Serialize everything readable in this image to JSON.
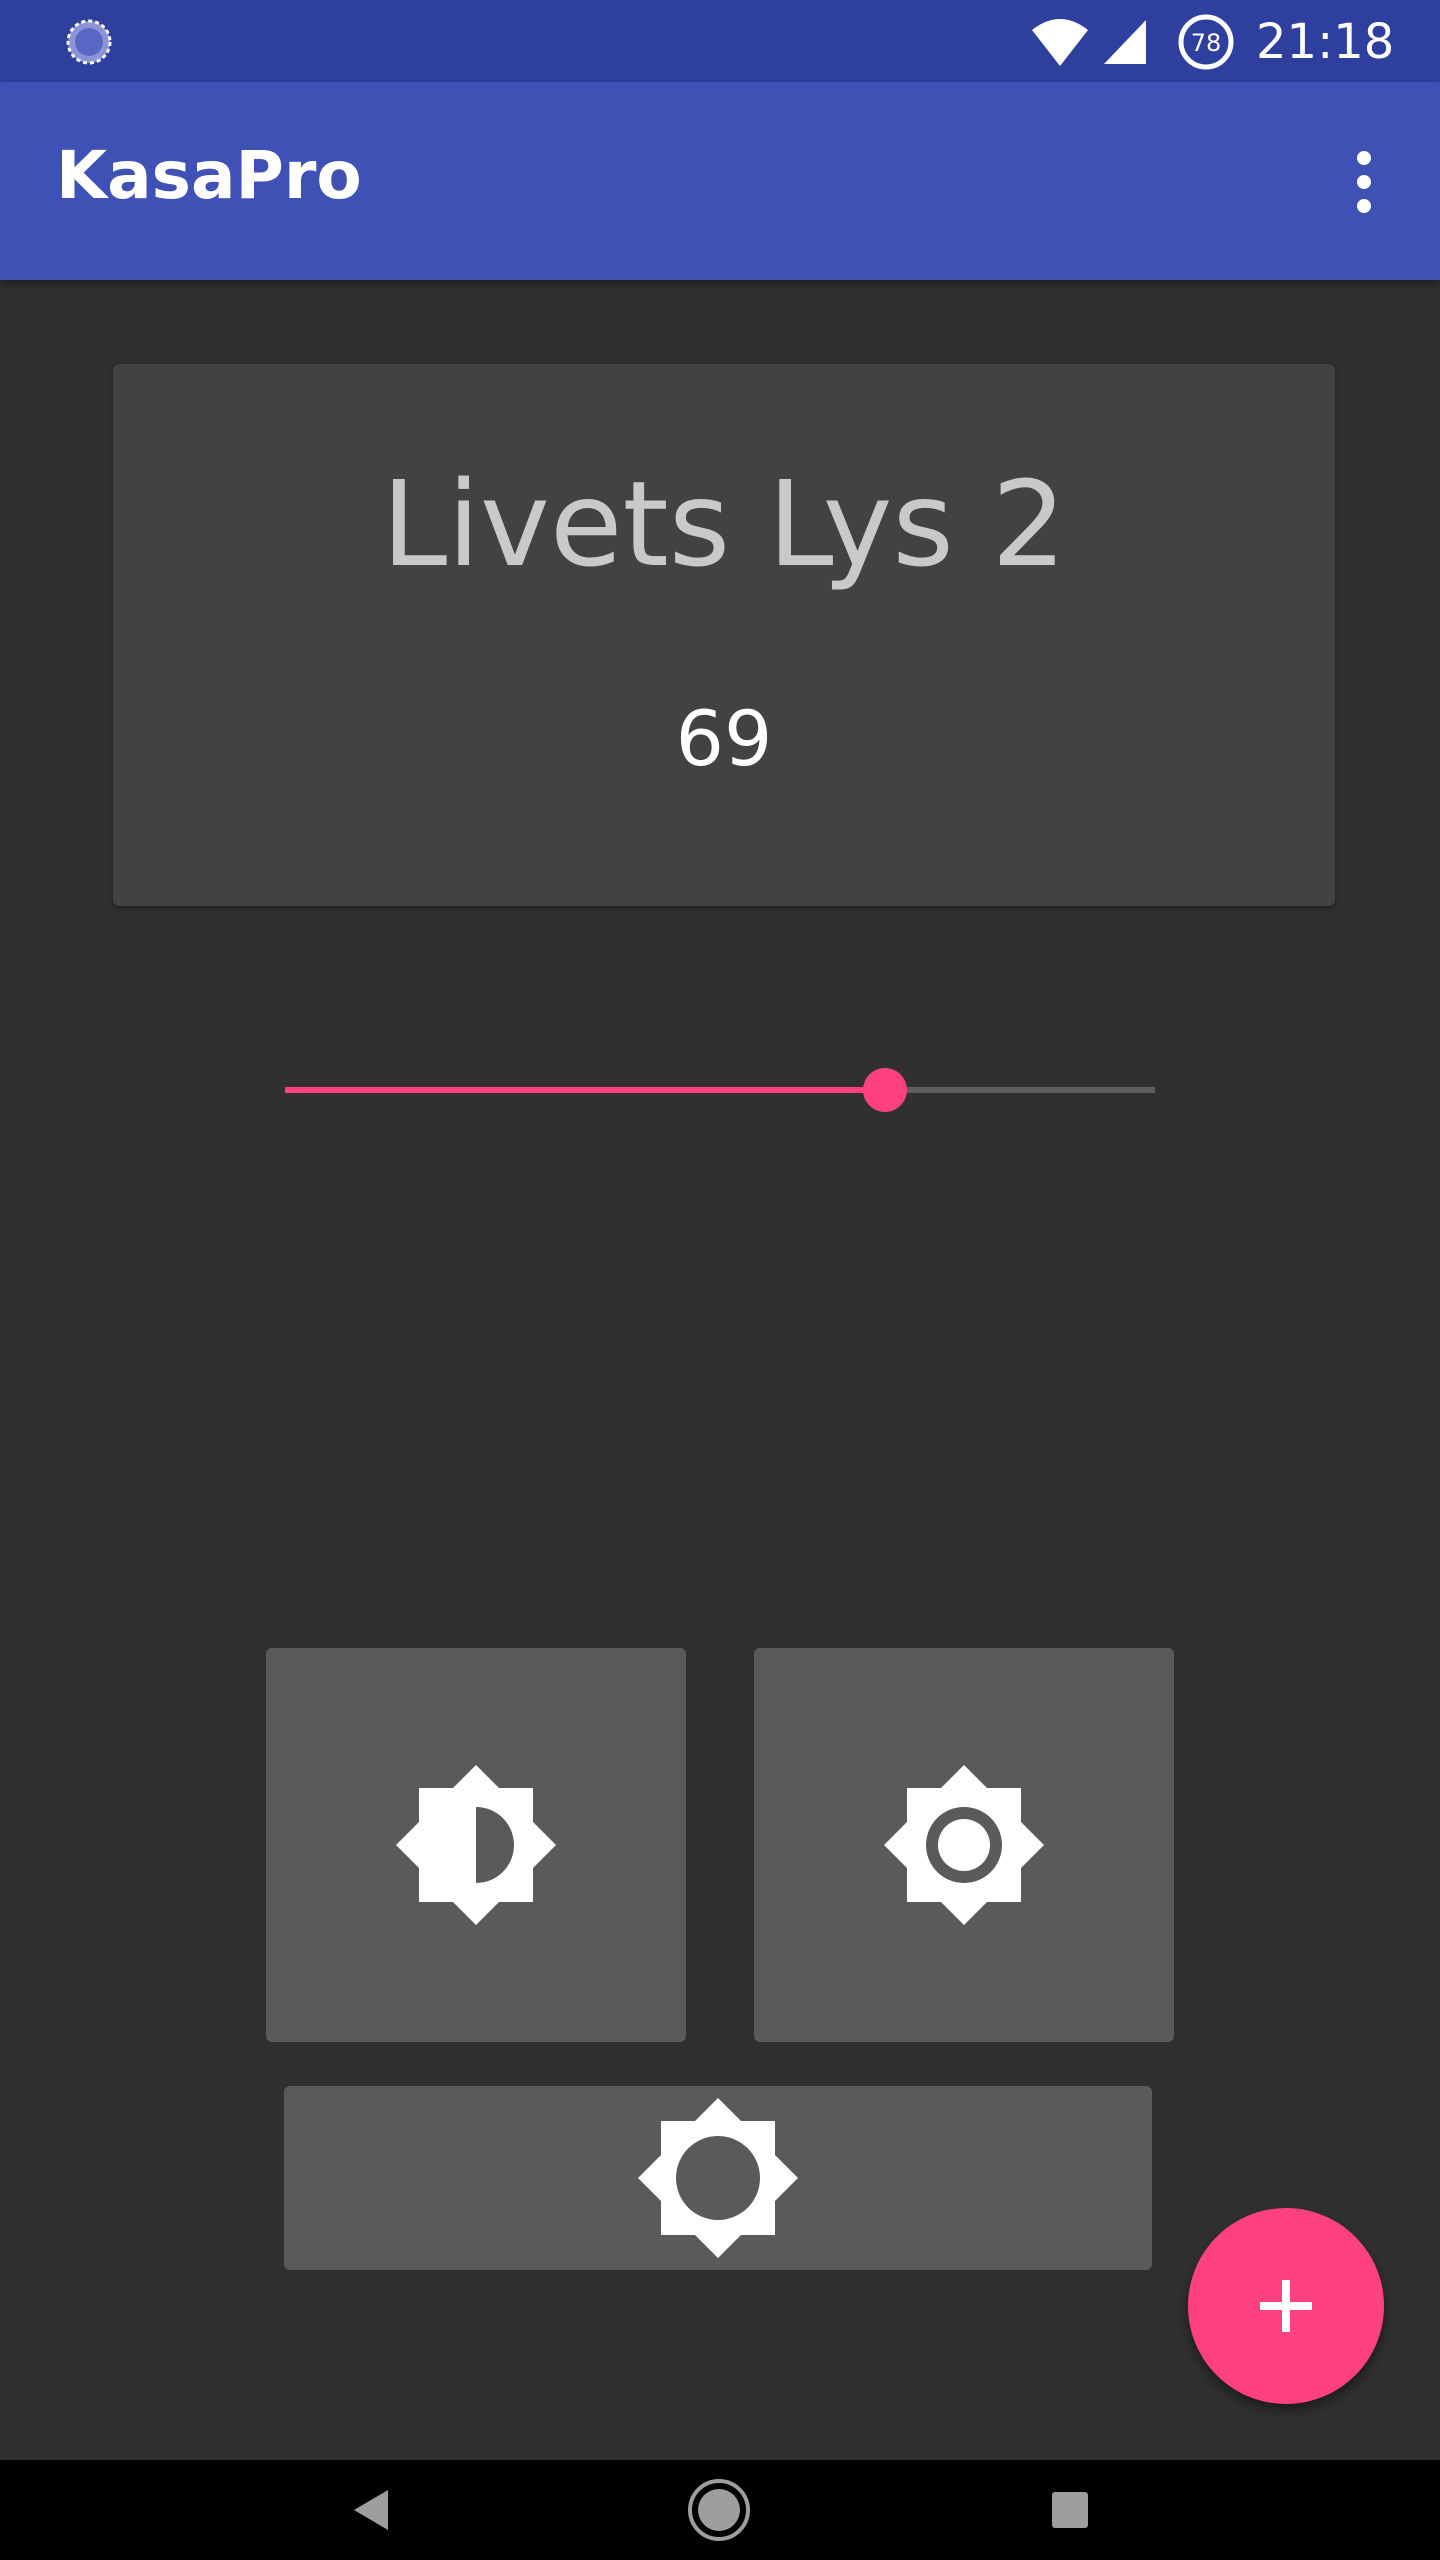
{
  "status_bar": {
    "time": "21:18",
    "battery_level": "78",
    "icons": [
      "sync-icon",
      "wifi-icon",
      "cell-signal-icon",
      "battery-icon"
    ]
  },
  "app_bar": {
    "title": "KasaPro",
    "menu_icon": "more-vert-icon"
  },
  "device": {
    "name": "Livets Lys 2",
    "brightness": "69"
  },
  "slider": {
    "value": 69,
    "min": 0,
    "max": 100
  },
  "buttons": {
    "low": "brightness-medium-icon",
    "medium": "brightness-low-icon",
    "high": "brightness-high-icon"
  },
  "fab": {
    "icon": "add-icon"
  },
  "nav_bar": {
    "icons": [
      "back-icon",
      "home-icon",
      "recents-icon"
    ]
  },
  "colors": {
    "status_bar": "#2f3f9e",
    "app_bar": "#3f51b5",
    "background": "#303030",
    "card": "#424242",
    "tile": "#5a5a5b",
    "accent": "#ff4081"
  }
}
